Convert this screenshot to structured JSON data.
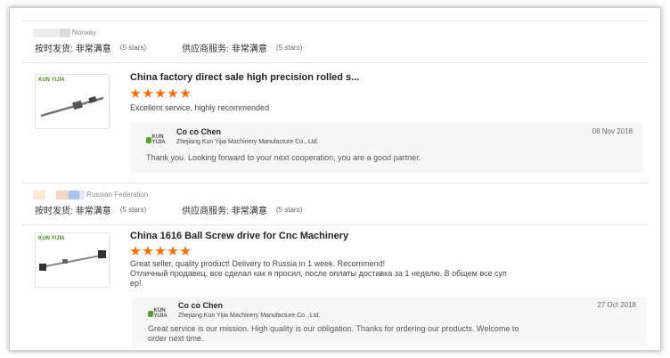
{
  "reviews": [
    {
      "country": "Norway",
      "flag_colors": [
        "#e8e8e8",
        "#d8d8d8"
      ],
      "ratings": [
        {
          "label": "按时发货:",
          "value": "非常满意",
          "stars": "(5 stars)"
        },
        {
          "label": "供应商服务:",
          "value": "非常满意",
          "stars": "(5 stars)"
        }
      ],
      "product_title": "China factory direct sale high precision rolled s...",
      "star_count": 5,
      "comment": "Excellent service, highly recommended",
      "reply": {
        "name": "Co co Chen",
        "company": "Zhejiang Kun Yijia Machinery Manufacture Co., Ltd.",
        "date": "08 Nov 2018",
        "text": "Thank you. Looking forward to your next cooperation, you are a good partner."
      }
    },
    {
      "country": "Russian Federation",
      "flag_colors": [
        "#fbe8d4",
        "#f4d3c5",
        "#a9c6ee",
        "#dfe8f5"
      ],
      "ratings": [
        {
          "label": "按时发货:",
          "value": "非常满意",
          "stars": "(5 stars)"
        },
        {
          "label": "供应商服务:",
          "value": "非常满意",
          "stars": "(5 stars)"
        }
      ],
      "product_title": "China 1616 Ball Screw drive for Cnc Machinery",
      "star_count": 5,
      "comment_lines": [
        "Great seller, quality product! Delivery to Russia in 1 week. Recommend!",
        "Отличный продавец, все сделал как я просил, после оплаты доставка за 1 неделю. В общем все суп",
        "ер!"
      ],
      "reply": {
        "name": "Co co Chen",
        "company": "Zhejiang Kun Yijia Machinery Manufacture Co., Ltd.",
        "date": "27 Oct 2018",
        "text_lines": [
          "Great service is our mission. High quality is our obligation. Thanks for ordering our products. Welcome to",
          "order next time."
        ]
      }
    }
  ],
  "logo_text": "KUN YIJIA",
  "accent_color": "#ff6a00",
  "icons": [
    "product-thumbnail",
    "star-icon",
    "supplier-logo-icon",
    "country-flag"
  ]
}
